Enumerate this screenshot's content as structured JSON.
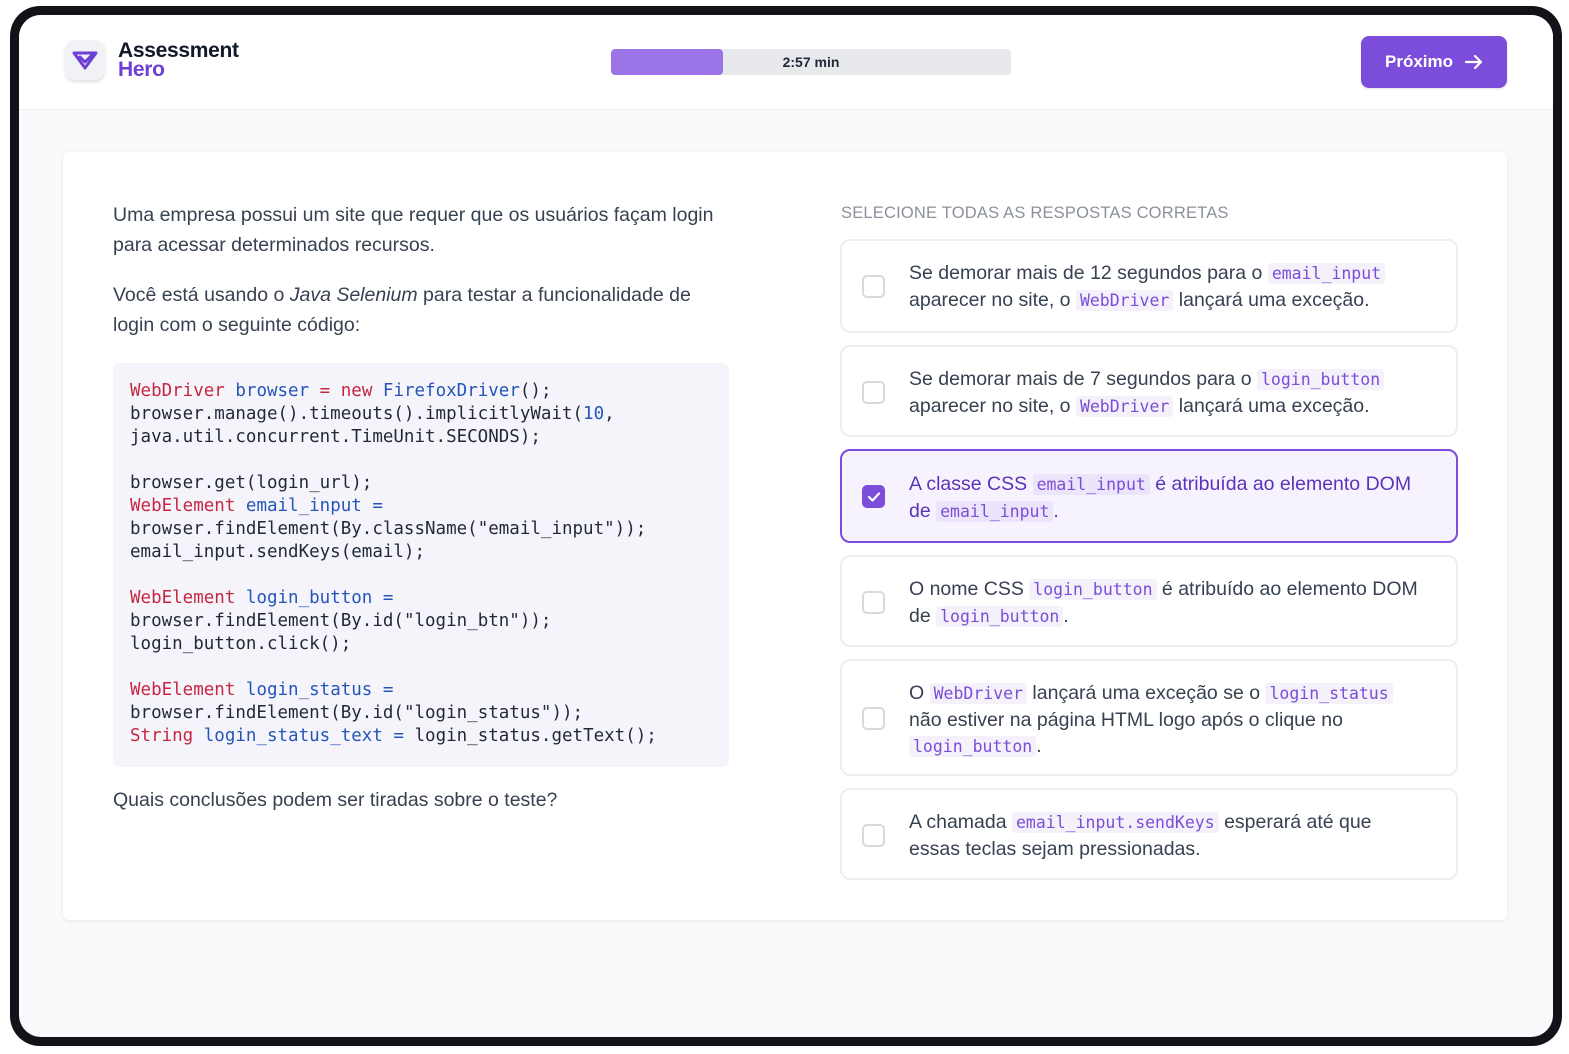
{
  "app": {
    "logo_line1": "Assessment",
    "logo_line2": "Hero",
    "timer_text": "2:57 min",
    "timer_progress": 0.28,
    "next_label": "Próximo",
    "accent_color": "#7c4ddb"
  },
  "question": {
    "para1": "Uma empresa possui um site que requer que os usuários façam login para acessar determinados recursos.",
    "para2_before": "Você está usando o ",
    "para2_em": "Java Selenium",
    "para2_after": " para testar a funcionalidade de login com o seguinte código:",
    "closing": "Quais conclusões podem ser tiradas sobre o teste?"
  },
  "code": {
    "l1a": "WebDriver",
    "l1b": " ",
    "l1c": "browser",
    "l1d": " = ",
    "l1e": "new",
    "l1f": " ",
    "l1g": "FirefoxDriver",
    "l1h": "();",
    "l2a": "browser.manage().timeouts().implicitlyWait(",
    "l2b": "10",
    "l2c": ",",
    "l3": "java.util.concurrent.TimeUnit.SECONDS);",
    "l5": "browser.get(login_url);",
    "l6a": "WebElement",
    "l6b": " ",
    "l6c": "email_input",
    "l6d": " =",
    "l7a": "browser.findElement(By.className(",
    "l7b": "\"email_input\"",
    "l7c": "));",
    "l8": "email_input.sendKeys(email);",
    "l10a": "WebElement",
    "l10b": " ",
    "l10c": "login_button",
    "l10d": " =",
    "l11a": "browser.findElement(By.id(",
    "l11b": "\"login_btn\"",
    "l11c": "));",
    "l12": "login_button.click();",
    "l14a": "WebElement",
    "l14b": " ",
    "l14c": "login_status",
    "l14d": " =",
    "l15a": "browser.findElement(By.id(",
    "l15b": "\"login_status\"",
    "l15c": "));",
    "l16a": "String",
    "l16b": " ",
    "l16c": "login_status_text",
    "l16d": " = ",
    "l16e": "login_status.getText();"
  },
  "answers": {
    "instruction": "SELECIONE TODAS AS RESPOSTAS CORRETAS",
    "o1": {
      "t1": "Se demorar mais de 12 segundos para o ",
      "c1": "email_input",
      "t2": " aparecer no site, o ",
      "c2": "WebDriver",
      "t3": " lançará uma exceção.",
      "checked": false
    },
    "o2": {
      "t1": "Se demorar mais de 7 segundos para o ",
      "c1": "login_button",
      "t2": " aparecer no site, o ",
      "c2": "WebDriver",
      "t3": " lançará uma exceção.",
      "checked": false
    },
    "o3": {
      "t1": "A classe CSS ",
      "c1": "email_input",
      "t2": " é atribuída ao elemento DOM de ",
      "c2": "email_input",
      "t3": ".",
      "checked": true
    },
    "o4": {
      "t1": "O nome CSS ",
      "c1": "login_button",
      "t2": " é atribuído ao elemento DOM de ",
      "c2": "login_button",
      "t3": ".",
      "checked": false
    },
    "o5": {
      "t1": "O ",
      "c1": "WebDriver",
      "t2": " lançará uma exceção se o ",
      "c2": "login_status",
      "t3": " não estiver na página HTML logo após o clique no ",
      "c3": "login_button",
      "t4": ".",
      "checked": false
    },
    "o6": {
      "t1": "A chamada ",
      "c1": "email_input.sendKeys",
      "t2": " esperará até que essas teclas sejam pressionadas.",
      "checked": false
    }
  }
}
